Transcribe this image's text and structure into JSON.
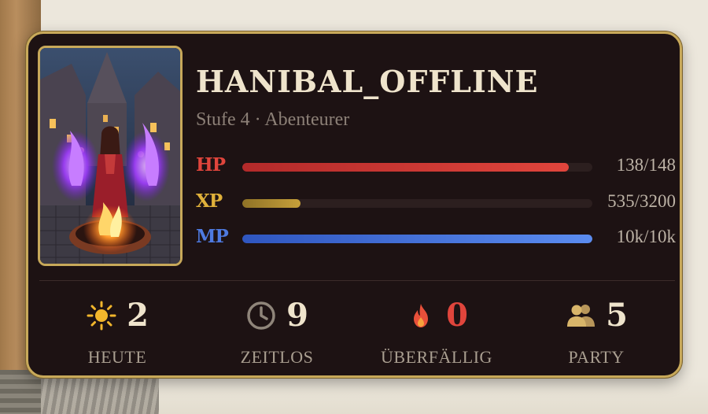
{
  "player": {
    "name": "HANIBAL_OFFLINE",
    "subtitle": "Stufe 4 · Abenteurer"
  },
  "stats": {
    "hp": {
      "label": "HP",
      "value_text": "138/148",
      "fill_fraction": 0.932,
      "color": "#e0453c"
    },
    "xp": {
      "label": "XP",
      "value_text": "535/3200",
      "fill_fraction": 0.167,
      "color": "#e0b13a"
    },
    "mp": {
      "label": "MP",
      "value_text": "10k/10k",
      "fill_fraction": 1.0,
      "color": "#4e7ae0"
    }
  },
  "counters": [
    {
      "icon": "sun-icon",
      "value": "2",
      "label": "HEUTE",
      "value_color": "#efe4cc",
      "icon_color": "#f2b62c"
    },
    {
      "icon": "clock-icon",
      "value": "9",
      "label": "ZEITLOS",
      "value_color": "#efe4cc",
      "icon_color": "#8f857a"
    },
    {
      "icon": "fire-icon",
      "value": "0",
      "label": "ÜBERFÄLLIG",
      "value_color": "#e0453c",
      "icon_color": "#e8503a"
    },
    {
      "icon": "party-icon",
      "value": "5",
      "label": "PARTY",
      "value_color": "#efe4cc",
      "icon_color": "#d8b56a"
    }
  ],
  "colors": {
    "card_bg": "#1d1213",
    "border_gold": "#c8a95a"
  }
}
